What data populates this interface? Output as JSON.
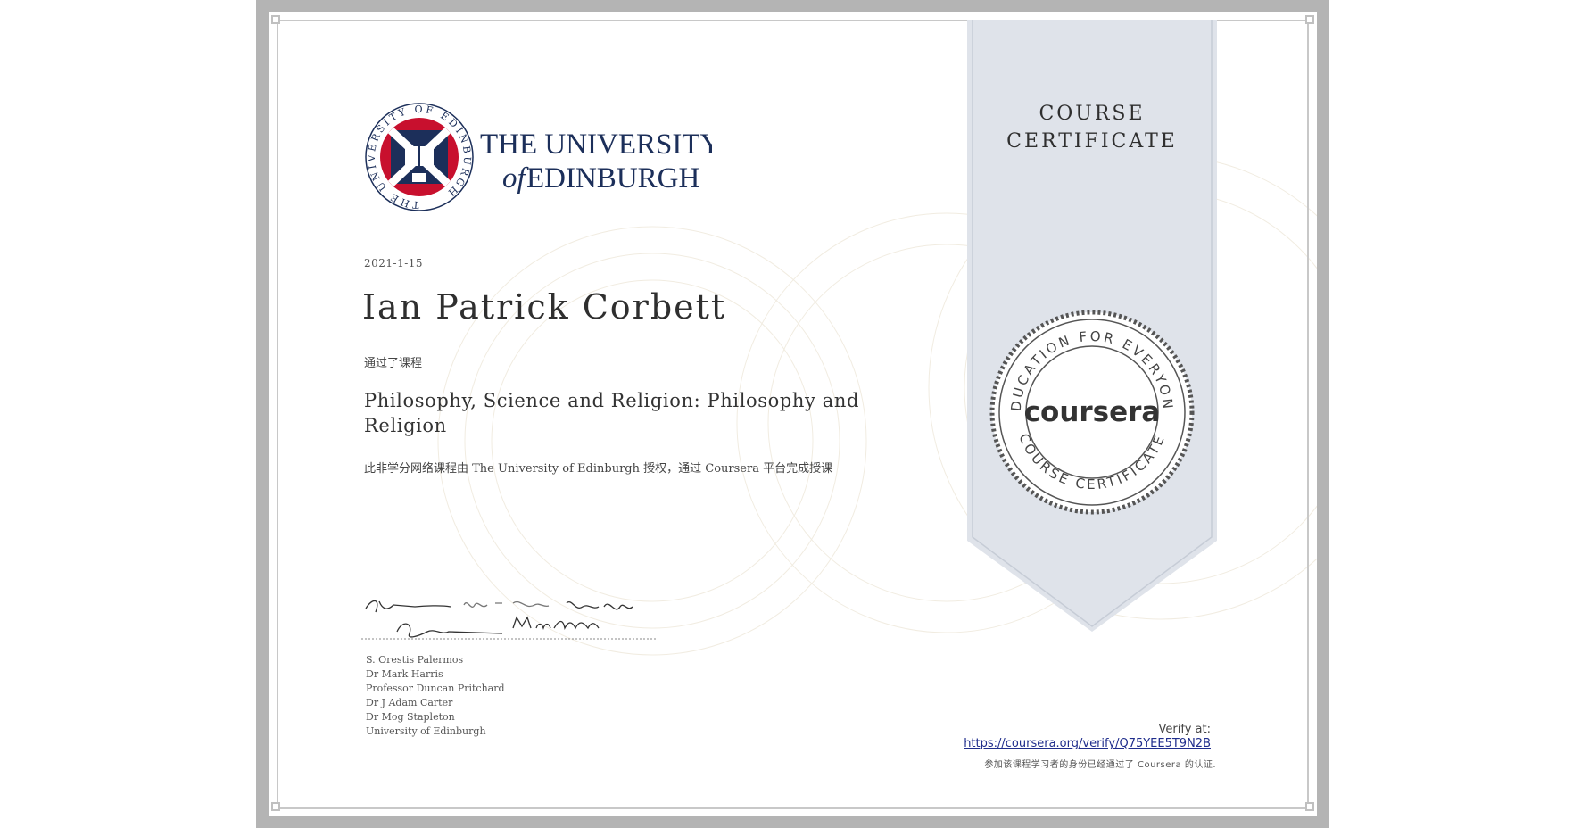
{
  "logo": {
    "name_line1": "THE UNIVERSITY",
    "name_line2_of": "of",
    "name_line2": "EDINBURGH",
    "seal_ring_text": "THE UNIVERSITY OF EDINBURGH"
  },
  "certificate": {
    "date": "2021-1-15",
    "recipient_name": "Ian Patrick Corbett",
    "completed_label": "通过了课程",
    "course_title": "Philosophy, Science and Religion: Philosophy and Religion",
    "description": "此非学分网络课程由 The University of Edinburgh 授权，通过 Coursera 平台完成授课"
  },
  "signatories": [
    "S. Orestis Palermos",
    "Dr Mark Harris",
    "Professor Duncan Pritchard",
    "Dr J Adam Carter",
    "Dr Mog Stapleton",
    "University of Edinburgh"
  ],
  "ribbon": {
    "title_line1": "COURSE",
    "title_line2": "CERTIFICATE",
    "seal_top_text": "EDUCATION FOR EVERYONE",
    "seal_bottom_text": "COURSE CERTIFICATE",
    "seal_brand": "coursera"
  },
  "verify": {
    "label": "Verify at:",
    "url": "https://coursera.org/verify/Q75YEE5T9N2B",
    "note": "参加该课程学习者的身份已经通过了 Coursera 的认证."
  },
  "colors": {
    "frame": "#b4b4b4",
    "ribbon": "#dfe3ea",
    "edinburgh_navy": "#1c2f5a",
    "edinburgh_red": "#c8102e",
    "link": "#1f2d8c"
  }
}
